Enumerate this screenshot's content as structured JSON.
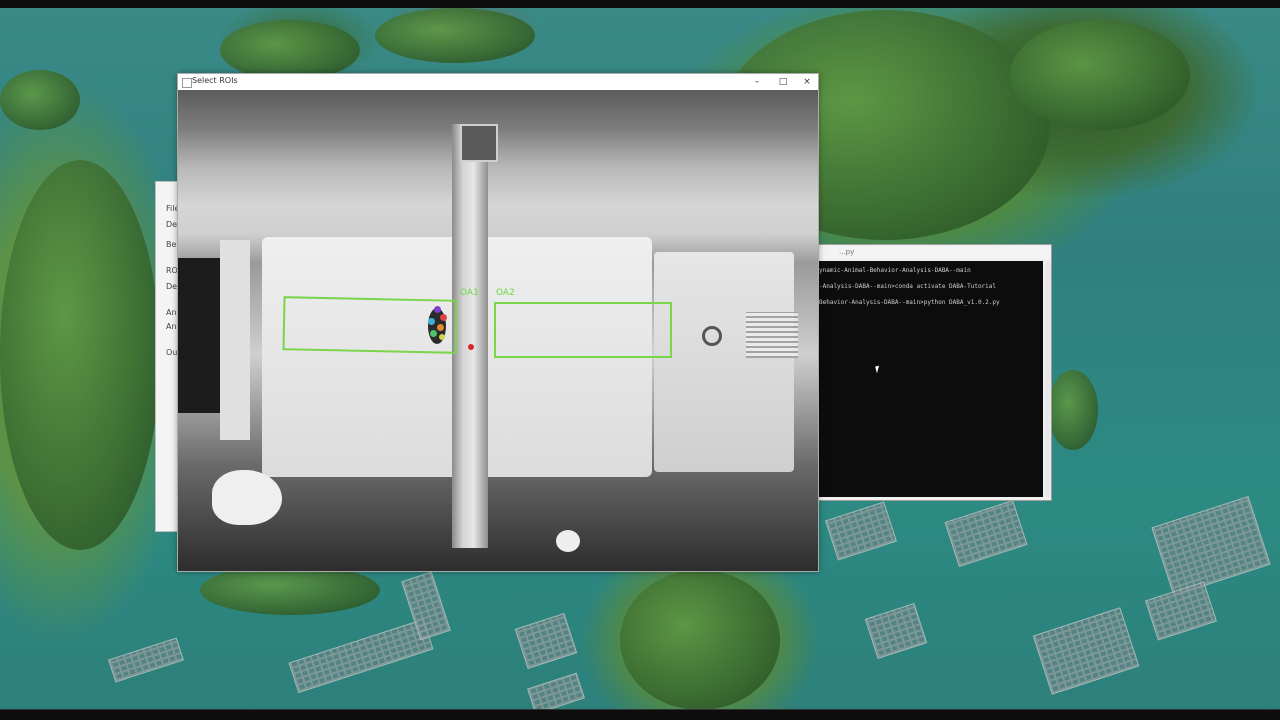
{
  "roi_window": {
    "title": "Select ROIs",
    "controls": {
      "minimize": "–",
      "maximize": "□",
      "close": "×"
    },
    "roi_labels": [
      "OA1",
      "OA2"
    ],
    "roi_color": "#7ad54a"
  },
  "background_window": {
    "labels": [
      "File",
      "De",
      "Be",
      "ROI",
      "De",
      "Ana",
      "Ana",
      "Out"
    ]
  },
  "terminal": {
    "title_fragment": "...py",
    "lines": [
      "ynamic-Animal-Behavior-Analysis-DABA--main",
      "-Analysis-DABA--main>conda activate DABA-Tutorial",
      "Behavior-Analysis-DABA--main>python DABA_v1.0.2.py"
    ]
  },
  "colors": {
    "terminal_bg": "#0c0c0c",
    "terminal_text": "#cfcfcf",
    "tracking_dot": "#d9242a"
  }
}
